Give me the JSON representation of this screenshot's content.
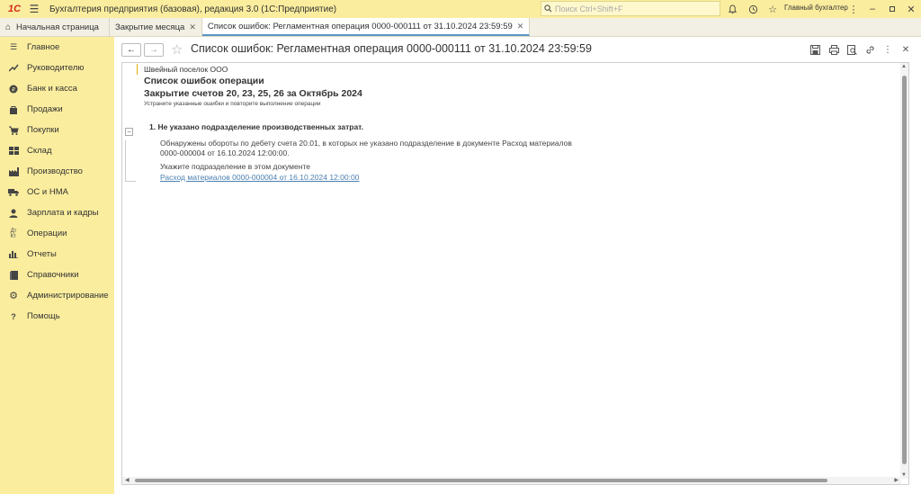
{
  "titlebar": {
    "logo": "1С",
    "app_title": "Бухгалтерия предприятия (базовая), редакция 3.0  (1С:Предприятие)",
    "search_placeholder": "Поиск Ctrl+Shift+F",
    "user": "Главный бухгалтер"
  },
  "tabs": [
    {
      "label": "Начальная страница"
    },
    {
      "label": "Закрытие месяца"
    },
    {
      "label": "Список ошибок: Регламентная операция 0000-000111 от 31.10.2024 23:59:59"
    }
  ],
  "sidebar": {
    "items": [
      {
        "label": "Главное",
        "icon": "menu-icon"
      },
      {
        "label": "Руководителю",
        "icon": "trend-icon"
      },
      {
        "label": "Банк и касса",
        "icon": "coin-icon"
      },
      {
        "label": "Продажи",
        "icon": "bag-icon"
      },
      {
        "label": "Покупки",
        "icon": "cart-icon"
      },
      {
        "label": "Склад",
        "icon": "warehouse-icon"
      },
      {
        "label": "Производство",
        "icon": "factory-icon"
      },
      {
        "label": "ОС и НМА",
        "icon": "truck-icon"
      },
      {
        "label": "Зарплата и кадры",
        "icon": "person-icon"
      },
      {
        "label": "Операции",
        "icon": "operations-icon"
      },
      {
        "label": "Отчеты",
        "icon": "report-icon"
      },
      {
        "label": "Справочники",
        "icon": "book-icon"
      },
      {
        "label": "Администрирование",
        "icon": "gear-icon"
      },
      {
        "label": "Помощь",
        "icon": "help-icon"
      }
    ]
  },
  "form": {
    "title": "Список ошибок: Регламентная операция 0000-000111 от 31.10.2024 23:59:59"
  },
  "report": {
    "organization": "Швейный поселок ООО",
    "heading": "Список ошибок операции",
    "subheading": "Закрытие счетов 20, 23, 25, 26 за Октябрь 2024",
    "hint": "Устраните указанные ошибки и повторите выполнение операции",
    "error_title": "1.  Не указано подразделение производственных затрат.",
    "error_desc_1": "Обнаружены обороты по дебету счета 20.01, в которых не указано подразделение в документе Расход материалов",
    "error_desc_2": "0000-000004 от 16.10.2024 12:00:00.",
    "todo": "Укажите подразделение в этом документе",
    "link": "Расход материалов 0000-000004 от 16.10.2024 12:00:00"
  },
  "colors": {
    "accent_yellow": "#fbed9e",
    "link_blue": "#4a7fb0",
    "logo_red": "#d42a1c"
  }
}
